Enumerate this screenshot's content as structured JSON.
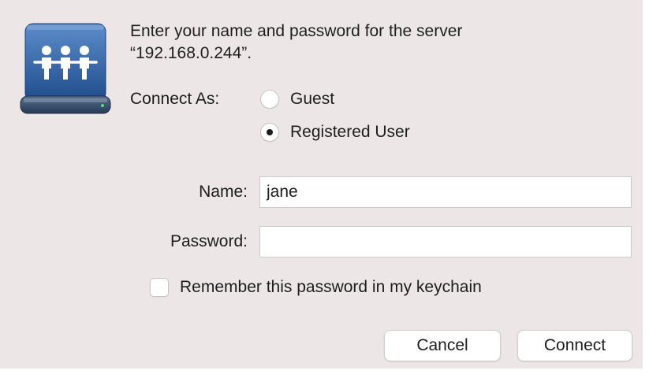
{
  "dialog": {
    "message_line1": "Enter your name and password for the server",
    "message_line2": "“192.168.0.244”.",
    "icon": "network-server-people-icon"
  },
  "connect_as": {
    "label": "Connect As:",
    "options": [
      {
        "label": "Guest",
        "selected": false
      },
      {
        "label": "Registered User",
        "selected": true
      }
    ]
  },
  "fields": {
    "name_label": "Name:",
    "name_value": "jane",
    "password_label": "Password:",
    "password_value": ""
  },
  "remember": {
    "label": "Remember this password in my keychain",
    "checked": false
  },
  "buttons": {
    "cancel": "Cancel",
    "connect": "Connect"
  },
  "colors": {
    "dialog_background": "#ece7e6",
    "icon_blue": "#2f5f9b"
  }
}
